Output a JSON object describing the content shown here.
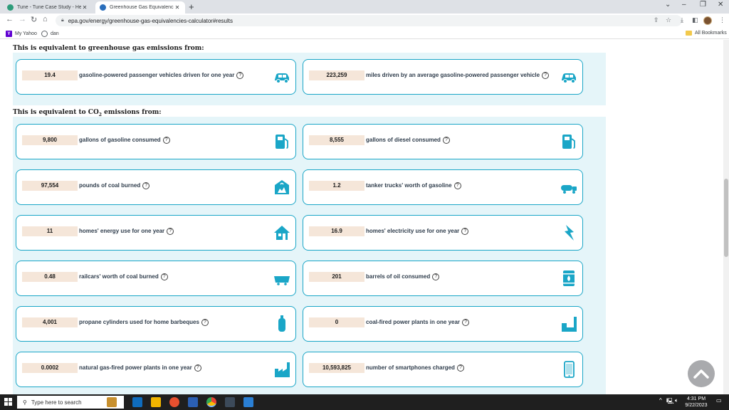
{
  "browser": {
    "tabs": [
      {
        "title": "Tune - Tune Case Study - Henkel",
        "active": false
      },
      {
        "title": "Greenhouse Gas Equivalencies C",
        "active": true
      }
    ],
    "url": "epa.gov/energy/greenhouse-gas-equivalencies-calculator#results",
    "bookmarks": [
      {
        "label": "My Yahoo"
      },
      {
        "label": "dan"
      }
    ],
    "all_bookmarks_label": "All Bookmarks"
  },
  "sections": [
    {
      "heading": "This is equivalent to greenhouse gas emissions from:",
      "cards": [
        {
          "value": "19.4",
          "label": "gasoline-powered passenger vehicles driven for one year",
          "icon": "car-icon"
        },
        {
          "value": "223,259",
          "label": "miles driven by an average gasoline-powered passenger vehicle",
          "icon": "car-icon"
        }
      ]
    },
    {
      "heading_prefix": "This is equivalent to CO",
      "heading_sub": "2",
      "heading_suffix": " emissions from:",
      "cards": [
        {
          "value": "9,800",
          "label": "gallons of gasoline consumed",
          "icon": "gas-pump-icon"
        },
        {
          "value": "8,555",
          "label": "gallons of diesel consumed",
          "icon": "gas-pump-icon"
        },
        {
          "value": "97,554",
          "label": "pounds of coal burned",
          "icon": "coal-icon"
        },
        {
          "value": "1.2",
          "label": "tanker trucks' worth of gasoline",
          "icon": "tanker-truck-icon"
        },
        {
          "value": "11",
          "label": "homes' energy use for one year",
          "icon": "house-icon"
        },
        {
          "value": "16.9",
          "label": "homes' electricity use for one year",
          "icon": "lightning-icon"
        },
        {
          "value": "0.48",
          "label": "railcars' worth of coal burned",
          "icon": "railcar-icon"
        },
        {
          "value": "201",
          "label": "barrels of oil consumed",
          "icon": "oil-barrel-icon"
        },
        {
          "value": "4,001",
          "label": "propane cylinders used for home barbeques",
          "icon": "propane-cylinder-icon"
        },
        {
          "value": "0",
          "label": "coal-fired power plants in one year",
          "icon": "power-plant-icon"
        },
        {
          "value": "0.0002",
          "label": "natural gas-fired power plants in one year",
          "icon": "gas-plant-icon"
        },
        {
          "value": "10,593,825",
          "label": "number of smartphones charged",
          "icon": "smartphone-icon"
        }
      ]
    }
  ],
  "help_glyph": "?",
  "taskbar": {
    "search_placeholder": "Type here to search",
    "time": "4:31 PM",
    "date": "9/22/2023"
  },
  "colors": {
    "card_border": "#1aa6c7",
    "panel_bg": "#e5f5f9",
    "value_bg": "#f5e6d9",
    "icon_blue": "#1aa6c7"
  }
}
